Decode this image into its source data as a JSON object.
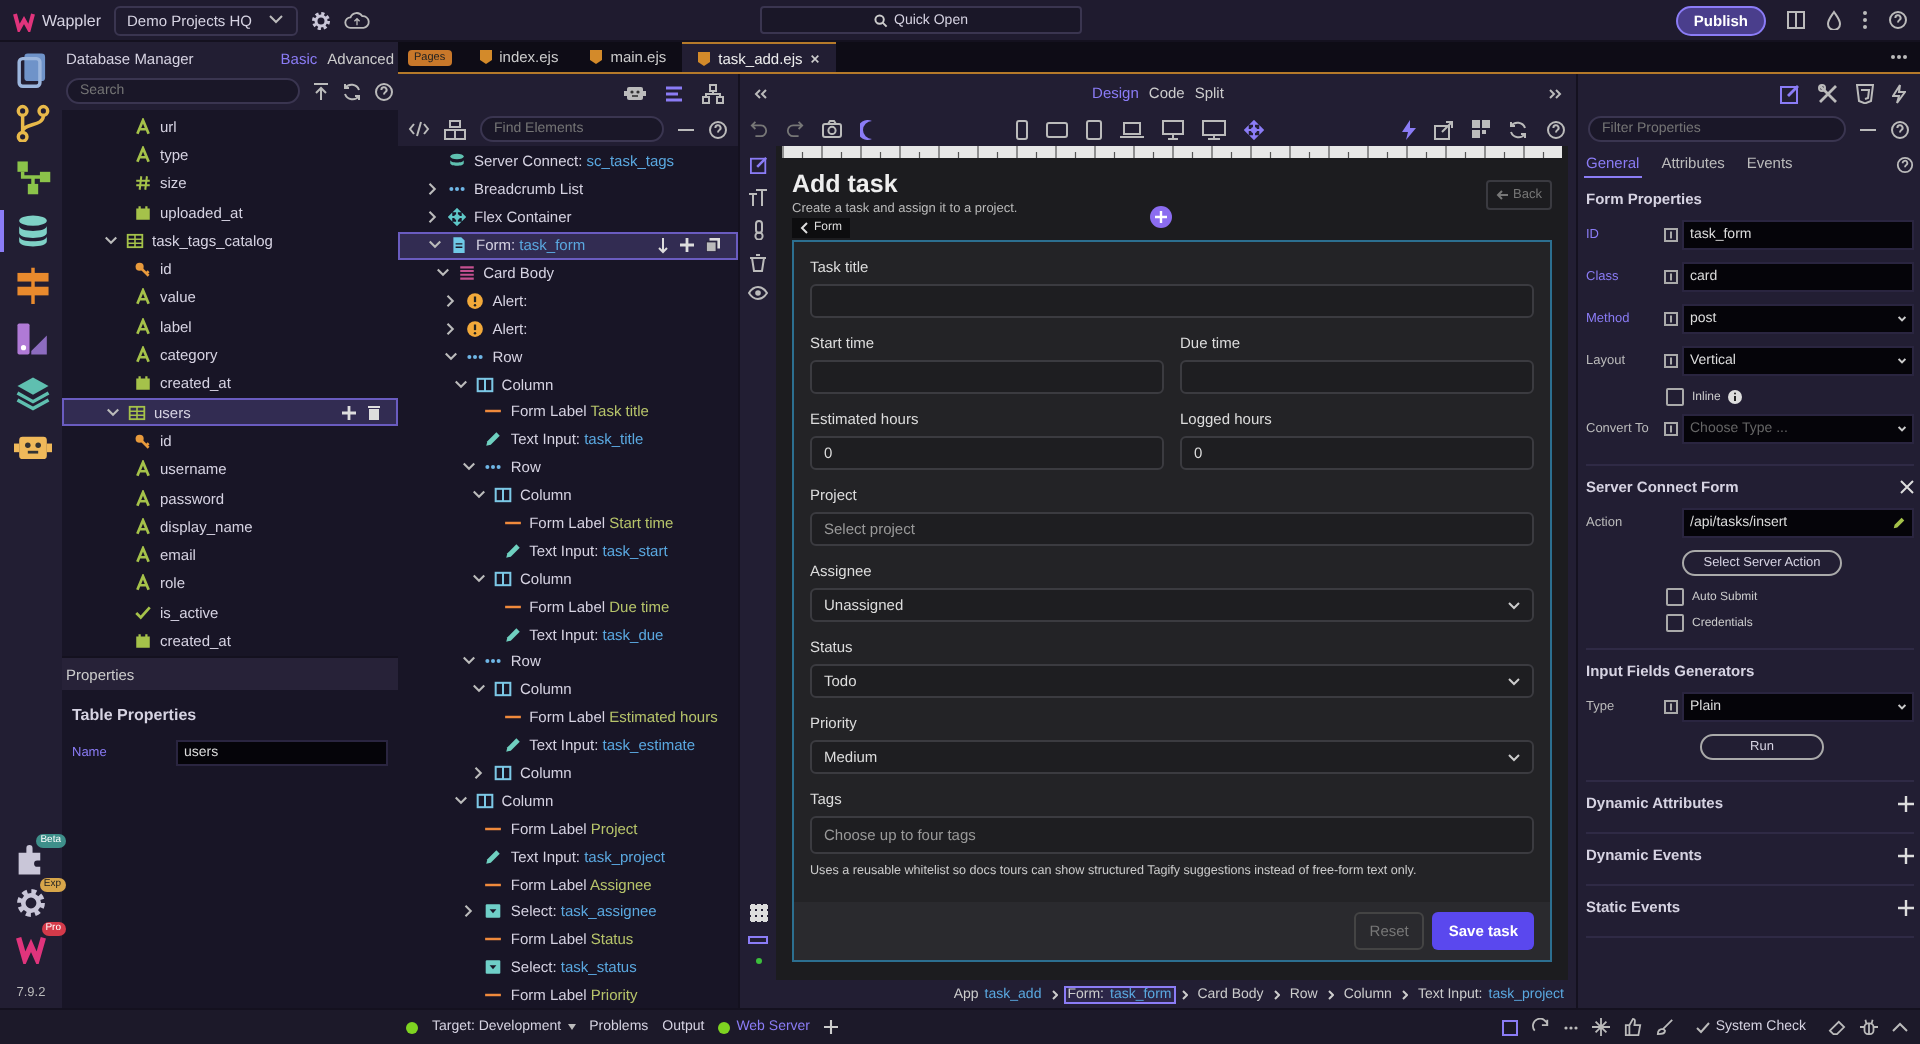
{
  "app": {
    "name": "Wappler",
    "project": "Demo Projects HQ",
    "quick_open": "Quick Open",
    "publish": "Publish",
    "version": "7.9.2"
  },
  "rail": [
    {
      "kind": "pages",
      "selected": false
    },
    {
      "kind": "git",
      "selected": false
    },
    {
      "kind": "flow",
      "selected": false
    },
    {
      "kind": "database",
      "selected": true
    },
    {
      "kind": "routes",
      "selected": false
    },
    {
      "kind": "palette",
      "selected": false
    },
    {
      "kind": "layers",
      "selected": false
    },
    {
      "kind": "robot",
      "selected": false
    }
  ],
  "rail_bottom": [
    {
      "kind": "extensions",
      "badge": "Beta"
    },
    {
      "kind": "settings",
      "badge": "Exp"
    },
    {
      "kind": "logo",
      "badge": "Pro"
    }
  ],
  "db_panel": {
    "title": "Database Manager",
    "modes": [
      {
        "label": "Basic",
        "selected": true
      },
      {
        "label": "Advanced",
        "selected": false
      }
    ],
    "search_placeholder": "Search",
    "tree": [
      {
        "children": [
          {
            "kind": "text",
            "label": "url",
            "selected": false
          },
          {
            "kind": "text",
            "label": "type",
            "selected": false
          },
          {
            "kind": "number",
            "label": "size",
            "selected": false
          },
          {
            "kind": "date",
            "label": "uploaded_at",
            "selected": false
          }
        ]
      },
      {
        "kind": "table",
        "label": "task_tags_catalog",
        "expanded": true,
        "selected": false,
        "children": [
          {
            "kind": "key",
            "label": "id",
            "selected": false
          },
          {
            "kind": "text",
            "label": "value",
            "selected": false
          },
          {
            "kind": "text",
            "label": "label",
            "selected": false
          },
          {
            "kind": "text",
            "label": "category",
            "selected": false
          },
          {
            "kind": "date",
            "label": "created_at",
            "selected": false
          }
        ]
      },
      {
        "kind": "table",
        "label": "users",
        "expanded": true,
        "selected": true,
        "children": [
          {
            "kind": "key",
            "label": "id",
            "selected": false
          },
          {
            "kind": "text",
            "label": "username",
            "selected": false
          },
          {
            "kind": "text",
            "label": "password",
            "selected": false
          },
          {
            "kind": "text",
            "label": "display_name",
            "selected": false
          },
          {
            "kind": "text",
            "label": "email",
            "selected": false
          },
          {
            "kind": "text",
            "label": "role",
            "selected": false
          },
          {
            "kind": "bool",
            "label": "is_active",
            "selected": false
          },
          {
            "kind": "date",
            "label": "created_at",
            "selected": false
          }
        ]
      }
    ]
  },
  "properties_panel": {
    "title": "Properties",
    "heading": "Table Properties",
    "fields": [
      {
        "label": "Name",
        "value": "users"
      }
    ]
  },
  "pages_badge": "Pages",
  "editor_tabs": [
    {
      "label": "index.ejs",
      "selected": false
    },
    {
      "label": "main.ejs",
      "selected": false
    },
    {
      "label": "task_add.ejs",
      "selected": true
    }
  ],
  "structure": {
    "find_placeholder": "Find Elements",
    "tree": [
      {
        "kind": "server",
        "label": "Server Connect:",
        "ref": "sc_task_tags",
        "selected": false
      },
      {
        "kind": "dots",
        "label": "Breadcrumb List",
        "expanded": false,
        "selected": false
      },
      {
        "kind": "flex",
        "label": "Flex Container",
        "expanded": false,
        "selected": false
      },
      {
        "kind": "form",
        "label": "Form:",
        "ref": "task_form",
        "expanded": true,
        "selected": true,
        "children": [
          {
            "kind": "card",
            "label": "Card Body",
            "expanded": true,
            "selected": false,
            "children": [
              {
                "kind": "alert",
                "label": "Alert:",
                "expanded": false,
                "selected": false
              },
              {
                "kind": "alert",
                "label": "Alert:",
                "expanded": false,
                "selected": false
              },
              {
                "kind": "dots",
                "label": "Row",
                "expanded": true,
                "selected": false,
                "children": [
                  {
                    "kind": "column",
                    "label": "Column",
                    "expanded": true,
                    "selected": false,
                    "children": [
                      {
                        "kind": "label",
                        "label": "Form Label",
                        "ref": "Task title",
                        "selected": false
                      },
                      {
                        "kind": "input",
                        "label": "Text Input:",
                        "ref": "task_title",
                        "selected": false
                      },
                      {
                        "kind": "dots",
                        "label": "Row",
                        "expanded": true,
                        "selected": false,
                        "children": [
                          {
                            "kind": "column",
                            "label": "Column",
                            "expanded": true,
                            "selected": false,
                            "children": [
                              {
                                "kind": "label",
                                "label": "Form Label",
                                "ref": "Start time",
                                "selected": false
                              },
                              {
                                "kind": "input",
                                "label": "Text Input:",
                                "ref": "task_start",
                                "selected": false
                              }
                            ]
                          },
                          {
                            "kind": "column",
                            "label": "Column",
                            "expanded": true,
                            "selected": false,
                            "children": [
                              {
                                "kind": "label",
                                "label": "Form Label",
                                "ref": "Due time",
                                "selected": false
                              },
                              {
                                "kind": "input",
                                "label": "Text Input:",
                                "ref": "task_due",
                                "selected": false
                              }
                            ]
                          }
                        ]
                      },
                      {
                        "kind": "dots",
                        "label": "Row",
                        "expanded": true,
                        "selected": false,
                        "children": [
                          {
                            "kind": "column",
                            "label": "Column",
                            "expanded": true,
                            "selected": false,
                            "children": [
                              {
                                "kind": "label",
                                "label": "Form Label",
                                "ref": "Estimated hours",
                                "selected": false
                              },
                              {
                                "kind": "input",
                                "label": "Text Input:",
                                "ref": "task_estimate",
                                "selected": false
                              }
                            ]
                          },
                          {
                            "kind": "column",
                            "label": "Column",
                            "expanded": false,
                            "selected": false
                          }
                        ]
                      }
                    ]
                  },
                  {
                    "kind": "column",
                    "label": "Column",
                    "expanded": true,
                    "selected": false,
                    "children": [
                      {
                        "kind": "label",
                        "label": "Form Label",
                        "ref": "Project",
                        "selected": false
                      },
                      {
                        "kind": "input",
                        "label": "Text Input:",
                        "ref": "task_project",
                        "selected": false
                      },
                      {
                        "kind": "label",
                        "label": "Form Label",
                        "ref": "Assignee",
                        "selected": false
                      },
                      {
                        "kind": "select",
                        "label": "Select:",
                        "ref": "task_assignee",
                        "expanded": false,
                        "selected": false
                      },
                      {
                        "kind": "label",
                        "label": "Form Label",
                        "ref": "Status",
                        "selected": false
                      },
                      {
                        "kind": "select",
                        "label": "Select:",
                        "ref": "task_status",
                        "selected": false
                      },
                      {
                        "kind": "label",
                        "label": "Form Label",
                        "ref": "Priority",
                        "selected": false
                      }
                    ]
                  }
                ]
              }
            ]
          }
        ]
      }
    ]
  },
  "view_modes": [
    {
      "label": "Design",
      "selected": true
    },
    {
      "label": "Code",
      "selected": false
    },
    {
      "label": "Split",
      "selected": false
    }
  ],
  "page": {
    "title": "Add task",
    "subtitle": "Create a task and assign it to a project.",
    "back": "Back",
    "form_tag": "Form",
    "rows": [
      {
        "fields": [
          {
            "kind": "input",
            "label": "Task title"
          }
        ]
      },
      {
        "fields": [
          {
            "kind": "input",
            "label": "Start time"
          },
          {
            "kind": "input",
            "label": "Due time"
          }
        ]
      },
      {
        "fields": [
          {
            "kind": "input",
            "label": "Estimated hours",
            "value": "0"
          },
          {
            "kind": "input",
            "label": "Logged hours",
            "value": "0"
          }
        ]
      },
      {
        "fields": [
          {
            "kind": "input",
            "label": "Project",
            "placeholder": "Select project"
          }
        ]
      },
      {
        "fields": [
          {
            "kind": "select",
            "label": "Assignee",
            "value": "Unassigned"
          }
        ]
      },
      {
        "fields": [
          {
            "kind": "select",
            "label": "Status",
            "value": "Todo"
          }
        ]
      },
      {
        "fields": [
          {
            "kind": "select",
            "label": "Priority",
            "value": "Medium"
          }
        ]
      },
      {
        "fields": [
          {
            "kind": "input",
            "label": "Tags",
            "placeholder": "Choose up to four tags"
          }
        ]
      }
    ],
    "help": "Uses a reusable whitelist so docs tours can show structured Tagify suggestions instead of free-form text only.",
    "reset": "Reset",
    "submit": "Save task"
  },
  "breadcrumb": [
    {
      "label": "App",
      "ref": "task_add",
      "selected": false
    },
    {
      "label": "Form:",
      "ref": "task_form",
      "selected": true
    },
    {
      "label": "Card Body",
      "selected": false
    },
    {
      "label": "Row",
      "selected": false
    },
    {
      "label": "Column",
      "selected": false
    },
    {
      "label": "Text Input:",
      "ref": "task_project",
      "selected": false
    }
  ],
  "props": {
    "filter_placeholder": "Filter Properties",
    "tabs": [
      {
        "label": "General",
        "selected": true
      },
      {
        "label": "Attributes",
        "selected": false
      },
      {
        "label": "Events",
        "selected": false
      }
    ],
    "sections": [
      {
        "kind": "form",
        "title": "Form Properties",
        "rows": [
          {
            "kind": "text",
            "label": "ID",
            "value": "task_form",
            "set": true
          },
          {
            "kind": "text",
            "label": "Class",
            "value": "card",
            "set": true
          },
          {
            "kind": "select",
            "label": "Method",
            "value": "post",
            "set": true
          },
          {
            "kind": "select",
            "label": "Layout",
            "value": "Vertical",
            "set": false
          },
          {
            "kind": "checkbox",
            "label": "Inline",
            "checked": false,
            "info": true
          },
          {
            "kind": "select",
            "label": "Convert To",
            "placeholder": "Choose Type ...",
            "set": false
          }
        ]
      },
      {
        "kind": "form",
        "title": "Server Connect Form",
        "closable": true,
        "rows": [
          {
            "kind": "action",
            "label": "Action",
            "value": "/api/tasks/insert",
            "set": false
          },
          {
            "kind": "button",
            "label": "Select Server Action"
          },
          {
            "kind": "checkbox",
            "label": "Auto Submit",
            "checked": false
          },
          {
            "kind": "checkbox",
            "label": "Credentials",
            "checked": false
          }
        ]
      },
      {
        "kind": "form",
        "title": "Input Fields Generators",
        "rows": [
          {
            "kind": "select",
            "label": "Type",
            "value": "Plain",
            "set": false
          },
          {
            "kind": "button",
            "label": "Run"
          }
        ]
      },
      {
        "kind": "collapsible",
        "title": "Dynamic Attributes",
        "expanded": false
      },
      {
        "kind": "collapsible",
        "title": "Dynamic Events",
        "expanded": false
      },
      {
        "kind": "collapsible",
        "title": "Static Events",
        "expanded": false
      }
    ]
  },
  "status_bar": {
    "target": "Target: Development",
    "tabs": [
      "Problems",
      "Output"
    ],
    "server": "Web Server",
    "system_check": "System Check"
  }
}
